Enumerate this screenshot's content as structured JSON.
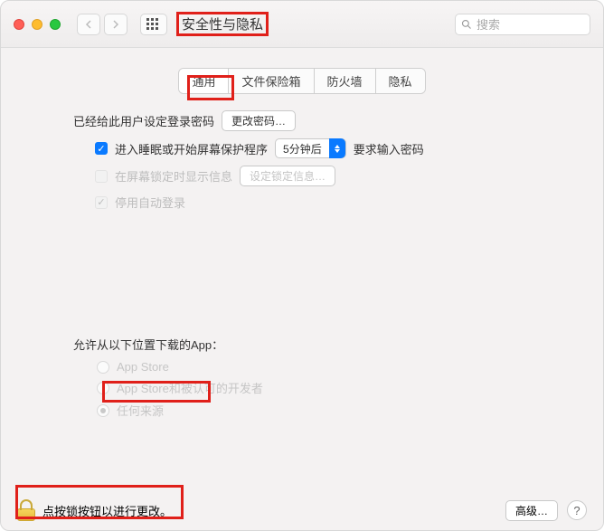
{
  "titlebar": {
    "title": "安全性与隐私",
    "search_placeholder": "搜索"
  },
  "tabs": [
    "通用",
    "文件保险箱",
    "防火墙",
    "隐私"
  ],
  "active_tab_index": 0,
  "form": {
    "pwd_set_label": "已经给此用户设定登录密码",
    "change_pwd_btn": "更改密码…",
    "sleep_checkbox_label": "进入睡眠或开始屏幕保护程序",
    "sleep_after_options_selected": "5分钟后",
    "sleep_after_suffix": "要求输入密码",
    "lock_msg_label": "在屏幕锁定时显示信息",
    "set_lock_msg_btn": "设定锁定信息…",
    "disable_autologin_label": "停用自动登录"
  },
  "allow_section": {
    "title": "允许从以下位置下载的App：",
    "options": [
      "App Store",
      "App Store和被认可的开发者",
      "任何来源"
    ],
    "selected_index": 2
  },
  "footer": {
    "lock_text": "点按锁按钮以进行更改。",
    "advanced_btn": "高级…"
  }
}
